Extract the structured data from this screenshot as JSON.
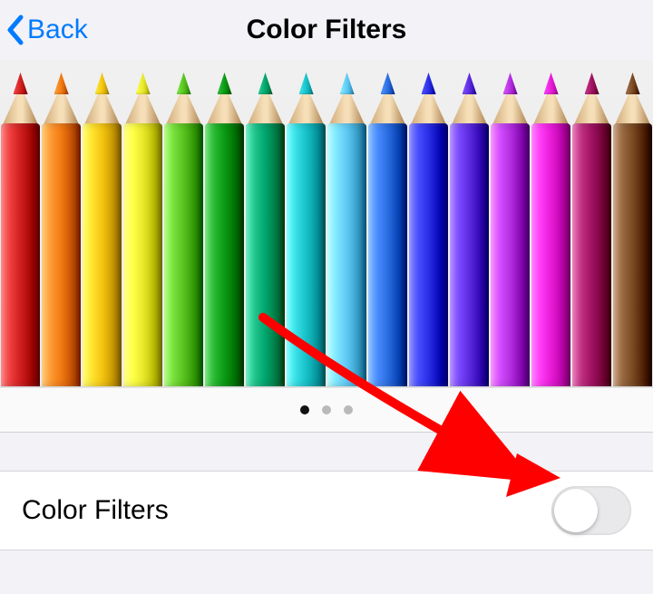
{
  "nav": {
    "back_label": "Back",
    "title": "Color Filters"
  },
  "preview": {
    "pencil_colors": [
      "#d01f1f",
      "#f07a13",
      "#f4c511",
      "#e9e92b",
      "#59c21e",
      "#0a9a13",
      "#00a56d",
      "#18c1c8",
      "#5fc8f4",
      "#2a6de0",
      "#2a2ee5",
      "#5b2adf",
      "#b32fe0",
      "#e81bd7",
      "#a01162",
      "#7a4a22"
    ]
  },
  "pager": {
    "page_count": 3,
    "current_index": 0
  },
  "setting": {
    "label": "Color Filters",
    "enabled": false
  },
  "annotation": {
    "arrow_color": "#ff0000"
  }
}
